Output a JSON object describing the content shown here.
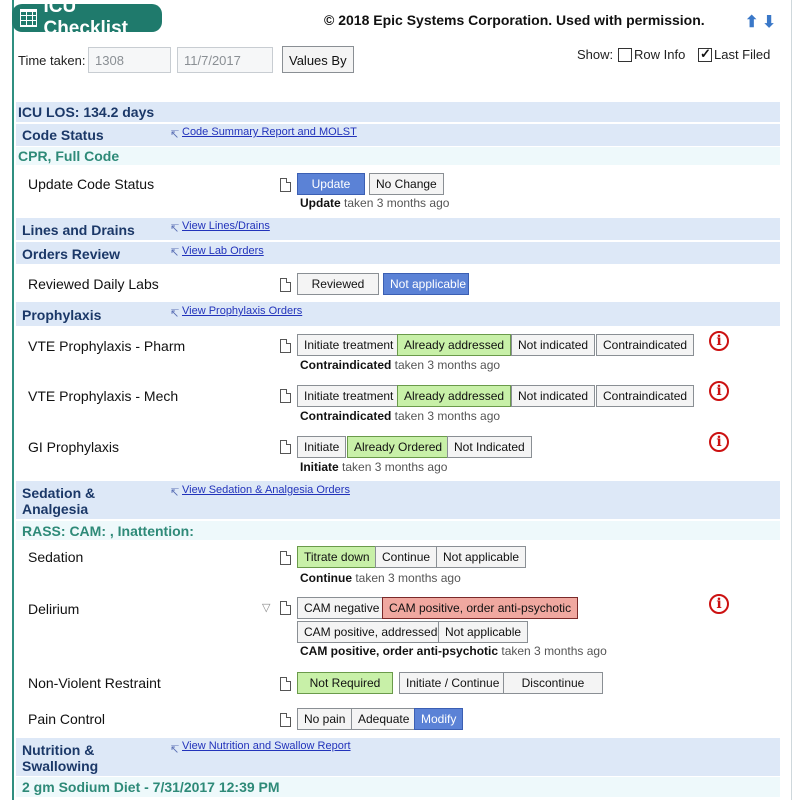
{
  "header": {
    "title": "ICU Checklist",
    "copyright": "© 2018 Epic Systems Corporation. Used with permission.",
    "arrow_up": "⬆",
    "arrow_down": "⬇"
  },
  "toolbar": {
    "time_taken_label": "Time taken:",
    "time_value": "1308",
    "date_value": "11/7/2017",
    "values_by_label": "Values By",
    "show_label": "Show:",
    "row_info_label": "Row Info",
    "last_filed_label": "Last Filed",
    "row_info_checked": false,
    "last_filed_checked": true
  },
  "sections": {
    "icu_los": "ICU LOS: 134.2 days",
    "code_status": {
      "heading": "Code Status",
      "link": "Code Summary Report and MOLST",
      "value": "CPR, Full Code"
    },
    "update_code_status": {
      "label": "Update Code Status",
      "btn_update": "Update",
      "btn_no_change": "No Change",
      "status_bold": "Update",
      "status_rest": " taken 3 months ago"
    },
    "lines_drains": {
      "heading": "Lines and Drains",
      "link": "View Lines/Drains"
    },
    "orders_review": {
      "heading": "Orders Review",
      "link": "View Lab Orders"
    },
    "reviewed_labs": {
      "label": "Reviewed Daily Labs",
      "btn_reviewed": "Reviewed",
      "btn_na": "Not applicable"
    },
    "prophylaxis": {
      "heading": "Prophylaxis",
      "link": "View Prophylaxis Orders"
    },
    "vte_pharm": {
      "label": "VTE Prophylaxis - Pharm",
      "btn_initiate": "Initiate treatment",
      "btn_addressed": "Already addressed",
      "btn_not_indicated": "Not indicated",
      "btn_contra": "Contraindicated",
      "status_bold": "Contraindicated",
      "status_rest": " taken 3 months ago"
    },
    "vte_mech": {
      "label": "VTE Prophylaxis - Mech",
      "btn_initiate": "Initiate treatment",
      "btn_addressed": "Already addressed",
      "btn_not_indicated": "Not indicated",
      "btn_contra": "Contraindicated",
      "status_bold": "Contraindicated",
      "status_rest": " taken 3 months ago"
    },
    "gi_prophylaxis": {
      "label": "GI Prophylaxis",
      "btn_initiate": "Initiate",
      "btn_ordered": "Already Ordered",
      "btn_not_indicated": "Not Indicated",
      "status_bold": "Initiate",
      "status_rest": " taken 3 months ago"
    },
    "sedation_analgesia": {
      "heading_line1": "Sedation &",
      "heading_line2": "Analgesia",
      "link": "View Sedation & Analgesia Orders",
      "value": "RASS: CAM: , Inattention:"
    },
    "sedation": {
      "label": "Sedation",
      "btn_titrate": "Titrate down",
      "btn_continue": "Continue",
      "btn_na": "Not applicable",
      "status_bold": "Continue",
      "status_rest": " taken 3 months ago"
    },
    "delirium": {
      "label": "Delirium",
      "btn_cam_neg": "CAM negative",
      "btn_cam_pos_order": "CAM positive, order anti-psychotic",
      "btn_cam_pos_addr": "CAM positive, addressed",
      "btn_na": "Not applicable",
      "status_bold": "CAM positive, order anti-psychotic",
      "status_rest": " taken 3 months ago"
    },
    "restraint": {
      "label": "Non-Violent Restraint",
      "btn_not_req": "Not Required",
      "btn_initiate": "Initiate / Continue",
      "btn_discontinue": "Discontinue"
    },
    "pain_control": {
      "label": "Pain Control",
      "btn_no_pain": "No pain",
      "btn_adequate": "Adequate",
      "btn_modify": "Modify"
    },
    "nutrition": {
      "heading_line1": "Nutrition &",
      "heading_line2": "Swallowing",
      "link": "View Nutrition and Swallow Report",
      "value": "2 gm Sodium Diet - 7/31/2017 12:39 PM"
    }
  },
  "icons": {
    "info": "info-circle-icon",
    "document": "document-icon",
    "link_arrow": "link-arrow-icon",
    "filter": "filter-icon",
    "grid": "grid-icon"
  },
  "colors": {
    "brand_teal": "#1f7a6c",
    "band_blue": "#dde8f7",
    "selected_blue": "#5b82d6",
    "selected_green": "#c8f0a8",
    "selected_red": "#f0a8a0",
    "alert_red": "#cc1111"
  }
}
